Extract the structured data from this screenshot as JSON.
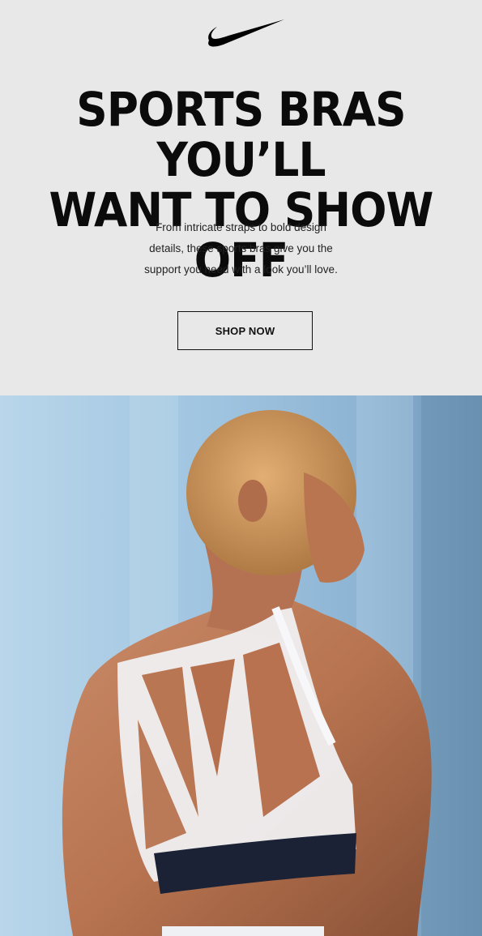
{
  "brand": {
    "logo_icon": "nike-swoosh-icon",
    "logo_color": "#000000"
  },
  "hero": {
    "headline_line1": "SPORTS BRAS YOU’LL",
    "headline_line2": "WANT TO SHOW OFF",
    "body_line1": "From intricate straps to bold design",
    "body_line2": "details, these sports bras give you the",
    "body_line3": "support you need with a look you’ll love.",
    "cta_label": "SHOP NOW"
  },
  "colors": {
    "header_background": "#e9e8e9",
    "text": "#0b0b0b",
    "photo_background": "#a9c9e2"
  },
  "image": {
    "subject": "woman-wearing-white-strappy-sports-bra-photo"
  }
}
